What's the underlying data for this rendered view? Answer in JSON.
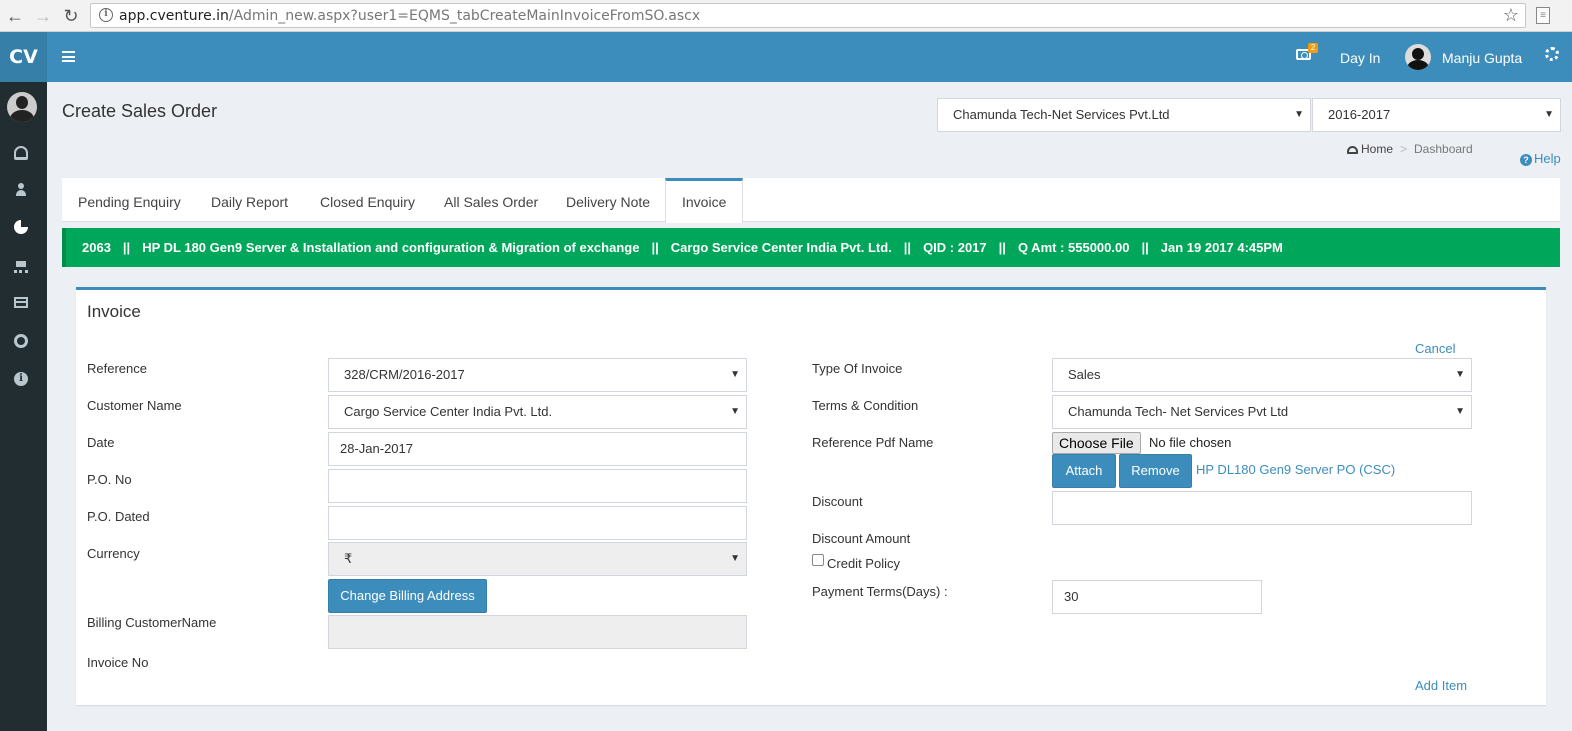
{
  "browser": {
    "url_host": "app.cventure.in",
    "url_path": "/Admin_new.aspx?user1=EQMS_tabCreateMainInvoiceFromSO.ascx"
  },
  "header": {
    "logo": "CV",
    "notification_count": "2",
    "day_in": "Day In",
    "user_name": "Manju Gupta"
  },
  "page": {
    "title": "Create Sales Order",
    "company_select": "Chamunda Tech-Net Services Pvt.Ltd",
    "year_select": "2016-2017",
    "breadcrumb_home": "Home",
    "breadcrumb_sep": ">",
    "breadcrumb_current": "Dashboard",
    "help": "Help"
  },
  "tabs": [
    {
      "label": "Pending Enquiry"
    },
    {
      "label": "Daily Report"
    },
    {
      "label": "Closed Enquiry"
    },
    {
      "label": "All Sales Order"
    },
    {
      "label": "Delivery Note"
    },
    {
      "label": "Invoice"
    }
  ],
  "banner": {
    "id": "2063",
    "description": "HP DL 180 Gen9 Server & Installation and configuration & Migration of exchange",
    "customer": "Cargo Service Center India Pvt. Ltd.",
    "qid": "QID : 2017",
    "qamt": "Q Amt : 555000.00",
    "date": "Jan 19 2017 4:45PM",
    "separator": "||"
  },
  "invoice": {
    "title": "Invoice",
    "cancel": "Cancel",
    "add_item": "Add Item",
    "left": {
      "reference_label": "Reference",
      "reference_value": "328/CRM/2016-2017",
      "customer_label": "Customer Name",
      "customer_value": "Cargo Service Center India Pvt. Ltd.",
      "date_label": "Date",
      "date_value": "28-Jan-2017",
      "po_no_label": "P.O. No",
      "po_no_value": "",
      "po_dated_label": "P.O. Dated",
      "po_dated_value": "",
      "currency_label": "Currency",
      "currency_value": "₹",
      "change_billing_button": "Change Billing Address",
      "billing_name_label": "Billing CustomerName",
      "billing_name_value": "",
      "invoice_no_label": "Invoice No"
    },
    "right": {
      "type_label": "Type Of Invoice",
      "type_value": "Sales",
      "terms_label": "Terms & Condition",
      "terms_value": "Chamunda Tech- Net Services Pvt Ltd",
      "ref_pdf_label": "Reference Pdf Name",
      "choose_file": "Choose File",
      "no_file": "No file chosen",
      "attach_button": "Attach",
      "remove_button": "Remove",
      "attached_file_link": "HP DL180 Gen9 Server PO (CSC)",
      "discount_label": "Discount",
      "discount_value": "",
      "discount_amount_label": "Discount Amount",
      "credit_policy_label": "Credit Policy",
      "credit_policy_checked": false,
      "payment_terms_label": "Payment Terms(Days) :",
      "payment_terms_value": "30"
    }
  }
}
